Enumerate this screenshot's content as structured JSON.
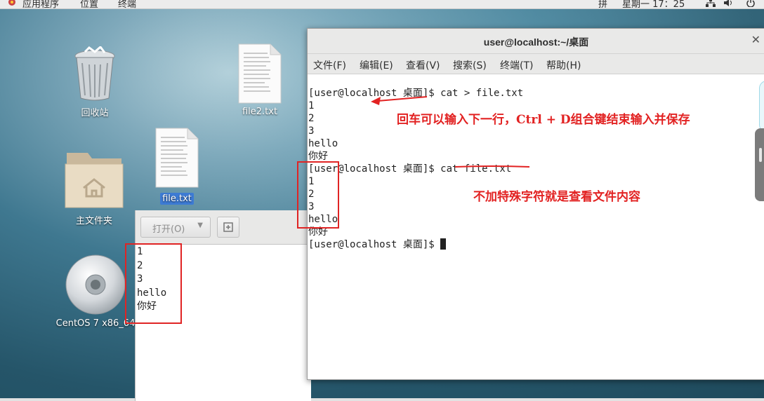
{
  "topbar": {
    "apps_label": "应用程序",
    "places_label": "位置",
    "terminal_label": "终端",
    "input_method": "拼",
    "datetime": "星期一 17：25"
  },
  "desktop": {
    "icons": [
      {
        "label": "回收站",
        "icon": "trash-icon"
      },
      {
        "label": "file2.txt",
        "icon": "text-file-icon"
      },
      {
        "label": "file.txt",
        "icon": "text-file-icon",
        "selected": true
      },
      {
        "label": "主文件夹",
        "icon": "home-folder-icon"
      },
      {
        "label": "CentOS 7 x86_64",
        "icon": "disc-icon"
      }
    ]
  },
  "gedit": {
    "open_button": "打开(O)",
    "lines": [
      "1",
      "2",
      "3",
      "hello",
      "你好"
    ]
  },
  "terminal": {
    "title": "user@localhost:~/桌面",
    "menu": [
      "文件(F)",
      "编辑(E)",
      "查看(V)",
      "搜索(S)",
      "终端(T)",
      "帮助(H)"
    ],
    "lines": [
      "[user@localhost 桌面]$ cat > file.txt",
      "1",
      "2",
      "3",
      "hello",
      "你好",
      "[user@localhost 桌面]$ cat file.txt",
      "1",
      "2",
      "3",
      "hello",
      "你好",
      "[user@localhost 桌面]$ "
    ]
  },
  "annotations": {
    "note1": "回车可以输入下一行，Ctrl + D组合键结束输入并保存",
    "note2": "不加特殊字符就是查看文件内容",
    "color": "#e22222"
  }
}
